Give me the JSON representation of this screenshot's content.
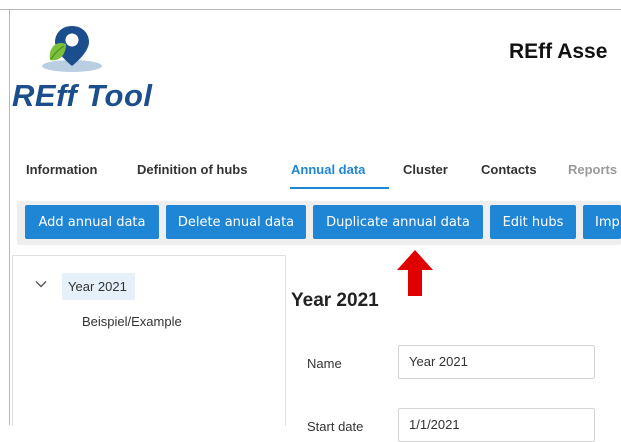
{
  "logo": {
    "text": "REff Tool"
  },
  "app": {
    "title": "REff Asse"
  },
  "tabs": [
    {
      "label": "Information",
      "state": "normal"
    },
    {
      "label": "Definition of hubs",
      "state": "normal"
    },
    {
      "label": "Annual data",
      "state": "active"
    },
    {
      "label": "Cluster",
      "state": "normal"
    },
    {
      "label": "Contacts",
      "state": "normal"
    },
    {
      "label": "Reports",
      "state": "disabled"
    }
  ],
  "toolbar": {
    "buttons": [
      {
        "label": "Add annual data"
      },
      {
        "label": "Delete anual data"
      },
      {
        "label": "Duplicate annual data"
      },
      {
        "label": "Edit hubs"
      },
      {
        "label": "Imp"
      }
    ]
  },
  "tree": {
    "item": {
      "label": "Year 2021",
      "expanded": true
    },
    "child": {
      "label": "Beispiel/Example"
    }
  },
  "content": {
    "title": "Year 2021",
    "fields": [
      {
        "label": "Name",
        "value": "Year 2021"
      },
      {
        "label": "Start date",
        "value": "1/1/2021"
      }
    ]
  },
  "colors": {
    "accent": "#1f86d6",
    "logo_text": "#1b4e8d",
    "arrow": "#e00000",
    "toolbar_bg": "#eeeeee",
    "selected_bg": "#e5f0fb"
  },
  "icons": {
    "logo": "location-pin-with-leaf-icon",
    "tree_toggle": "chevron-down-icon",
    "annotation": "red-up-arrow"
  }
}
